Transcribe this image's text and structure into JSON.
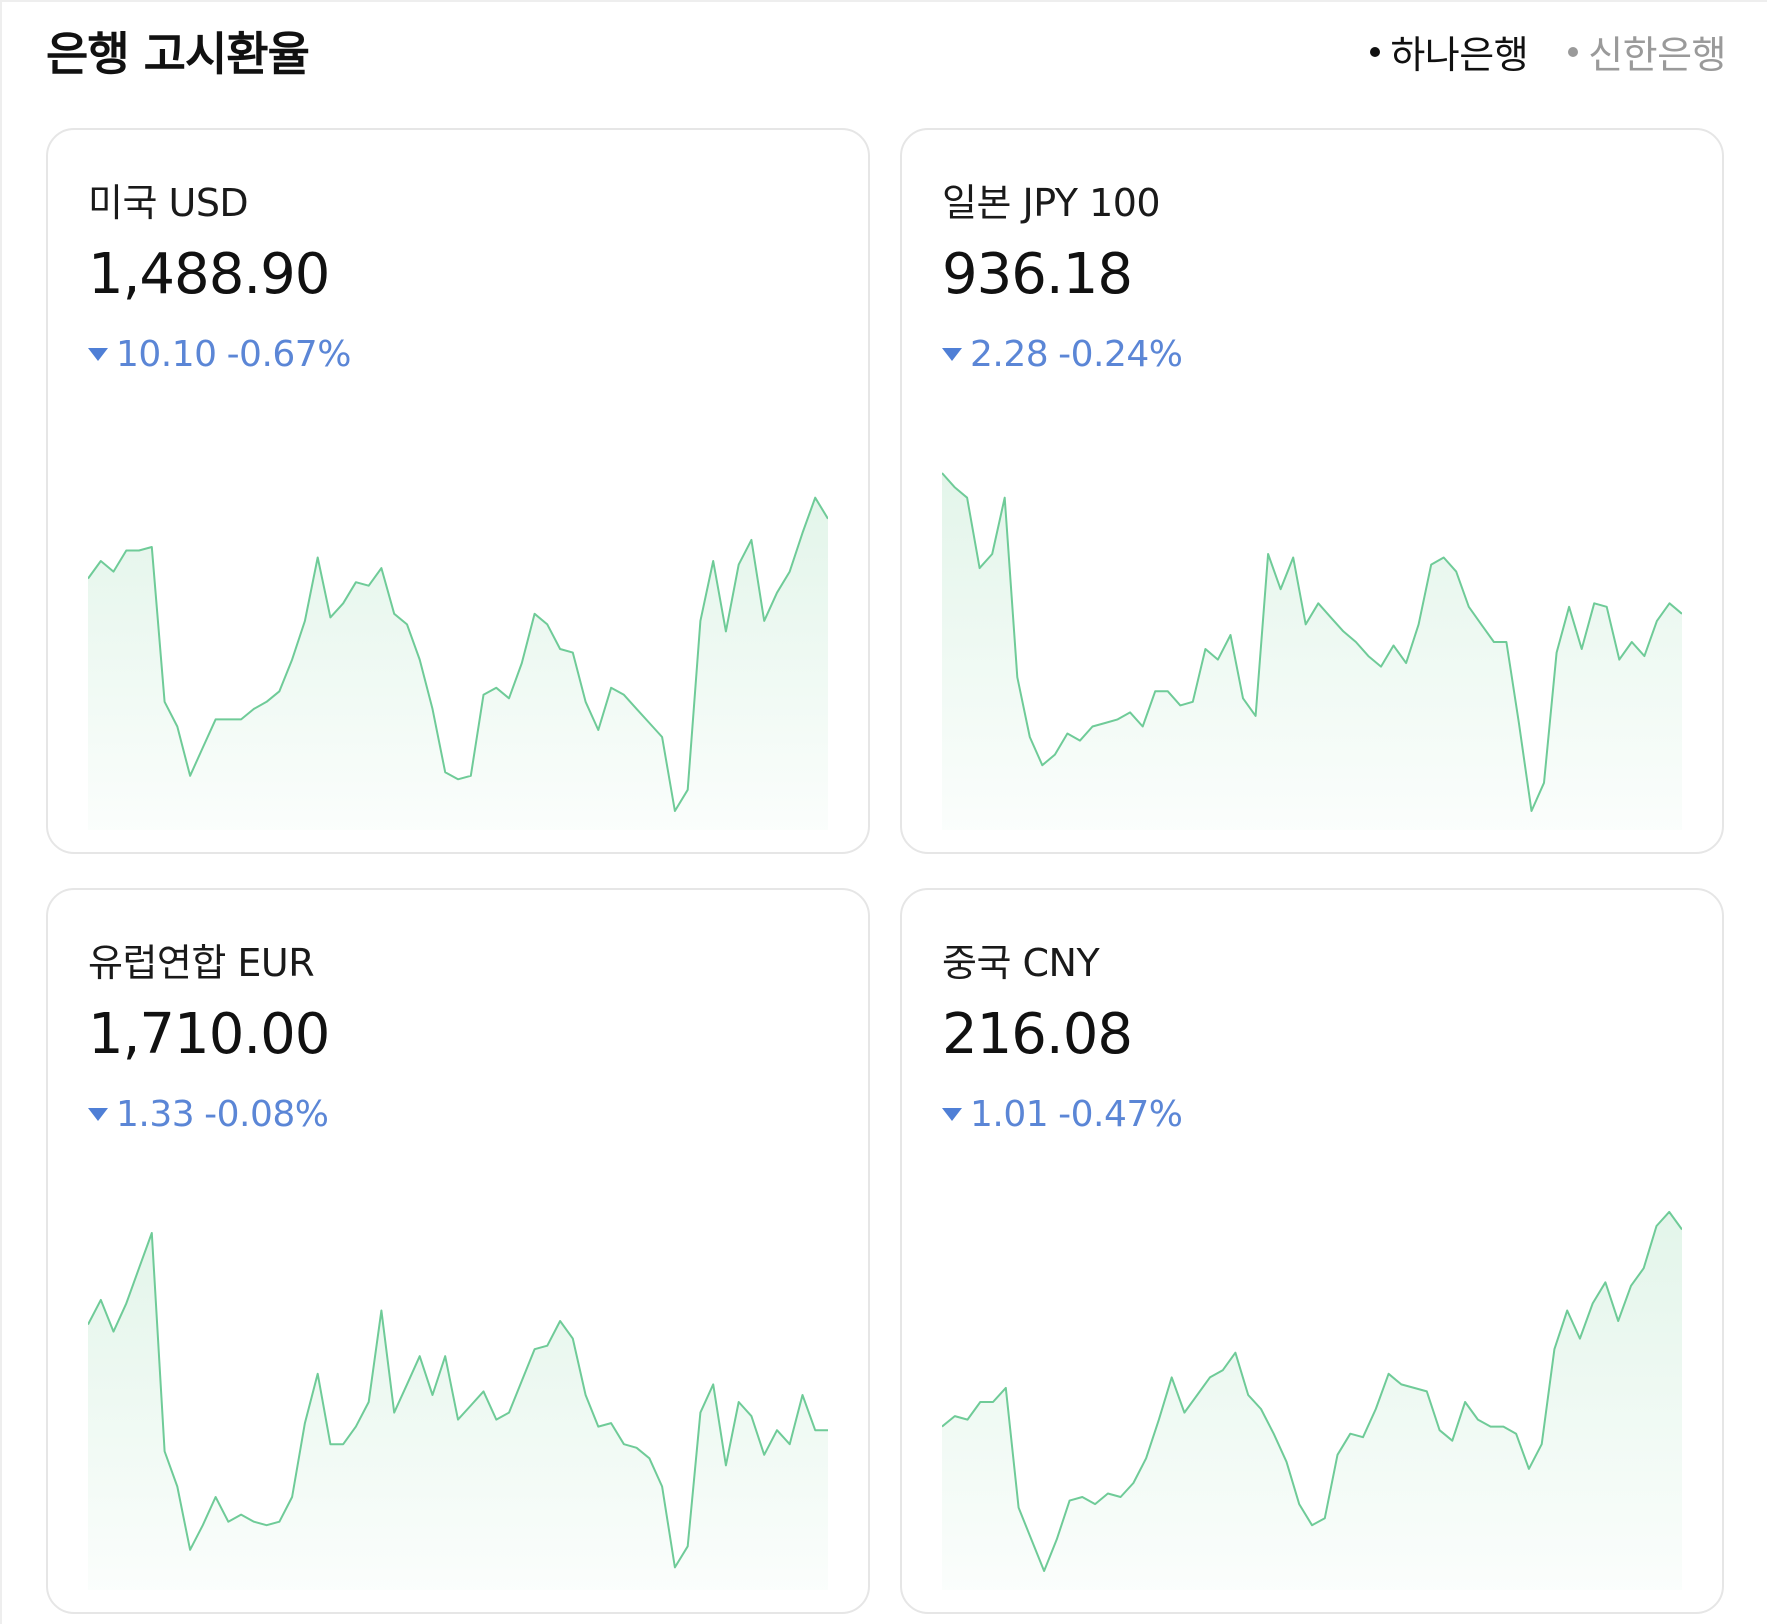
{
  "header": {
    "title": "은행 고시환율",
    "banks": [
      {
        "label": "하나은행",
        "active": true
      },
      {
        "label": "신한은행",
        "active": false
      }
    ]
  },
  "colors": {
    "down": "#5b86d6",
    "line": "#6fcb98",
    "fill": "#e3f5ea"
  },
  "cards": [
    {
      "name": "미국 USD",
      "rate": "1,488.90",
      "direction": "down",
      "change": "10.10",
      "pct": "-0.67%",
      "chart_data": {
        "type": "area",
        "ylim": [
          0,
          1
        ],
        "values": [
          0.68,
          0.73,
          0.7,
          0.76,
          0.76,
          0.77,
          0.33,
          0.26,
          0.12,
          0.2,
          0.28,
          0.28,
          0.28,
          0.31,
          0.33,
          0.36,
          0.45,
          0.56,
          0.74,
          0.57,
          0.61,
          0.67,
          0.66,
          0.71,
          0.58,
          0.55,
          0.45,
          0.31,
          0.13,
          0.11,
          0.12,
          0.35,
          0.37,
          0.34,
          0.44,
          0.58,
          0.55,
          0.48,
          0.47,
          0.33,
          0.25,
          0.37,
          0.35,
          0.31,
          0.27,
          0.23,
          0.02,
          0.08,
          0.56,
          0.73,
          0.53,
          0.72,
          0.79,
          0.56,
          0.64,
          0.7,
          0.81,
          0.91,
          0.85
        ]
      }
    },
    {
      "name": "일본 JPY 100",
      "rate": "936.18",
      "direction": "down",
      "change": "2.28",
      "pct": "-0.24%",
      "chart_data": {
        "type": "area",
        "ylim": [
          0,
          1
        ],
        "values": [
          0.98,
          0.94,
          0.91,
          0.71,
          0.75,
          0.91,
          0.4,
          0.23,
          0.15,
          0.18,
          0.24,
          0.22,
          0.26,
          0.27,
          0.28,
          0.3,
          0.26,
          0.36,
          0.36,
          0.32,
          0.33,
          0.48,
          0.45,
          0.52,
          0.34,
          0.29,
          0.75,
          0.65,
          0.74,
          0.55,
          0.61,
          0.57,
          0.53,
          0.5,
          0.46,
          0.43,
          0.49,
          0.44,
          0.55,
          0.72,
          0.74,
          0.7,
          0.6,
          0.55,
          0.5,
          0.5,
          0.27,
          0.02,
          0.1,
          0.47,
          0.6,
          0.48,
          0.61,
          0.6,
          0.45,
          0.5,
          0.46,
          0.56,
          0.61,
          0.58
        ]
      }
    },
    {
      "name": "유럽연합 EUR",
      "rate": "1,710.00",
      "direction": "down",
      "change": "1.33",
      "pct": "-0.08%",
      "chart_data": {
        "type": "area",
        "ylim": [
          0,
          1
        ],
        "values": [
          0.72,
          0.79,
          0.7,
          0.78,
          0.88,
          0.98,
          0.36,
          0.26,
          0.08,
          0.15,
          0.23,
          0.16,
          0.18,
          0.16,
          0.15,
          0.16,
          0.23,
          0.44,
          0.58,
          0.38,
          0.38,
          0.43,
          0.5,
          0.76,
          0.47,
          0.55,
          0.63,
          0.52,
          0.63,
          0.45,
          0.49,
          0.53,
          0.45,
          0.47,
          0.56,
          0.65,
          0.66,
          0.73,
          0.68,
          0.52,
          0.43,
          0.44,
          0.38,
          0.37,
          0.34,
          0.26,
          0.03,
          0.09,
          0.47,
          0.55,
          0.32,
          0.5,
          0.46,
          0.35,
          0.42,
          0.38,
          0.52,
          0.42,
          0.42
        ]
      }
    },
    {
      "name": "중국 CNY",
      "rate": "216.08",
      "direction": "down",
      "change": "1.01",
      "pct": "-0.47%",
      "chart_data": {
        "type": "area",
        "ylim": [
          0,
          1
        ],
        "values": [
          0.43,
          0.46,
          0.45,
          0.5,
          0.5,
          0.54,
          0.2,
          0.11,
          0.02,
          0.11,
          0.22,
          0.23,
          0.21,
          0.24,
          0.23,
          0.27,
          0.34,
          0.45,
          0.57,
          0.47,
          0.52,
          0.57,
          0.59,
          0.64,
          0.52,
          0.48,
          0.41,
          0.33,
          0.21,
          0.15,
          0.17,
          0.35,
          0.41,
          0.4,
          0.48,
          0.58,
          0.55,
          0.54,
          0.53,
          0.42,
          0.39,
          0.5,
          0.45,
          0.43,
          0.43,
          0.41,
          0.31,
          0.38,
          0.65,
          0.76,
          0.68,
          0.78,
          0.84,
          0.73,
          0.83,
          0.88,
          1.0,
          1.04,
          0.99
        ]
      }
    }
  ]
}
